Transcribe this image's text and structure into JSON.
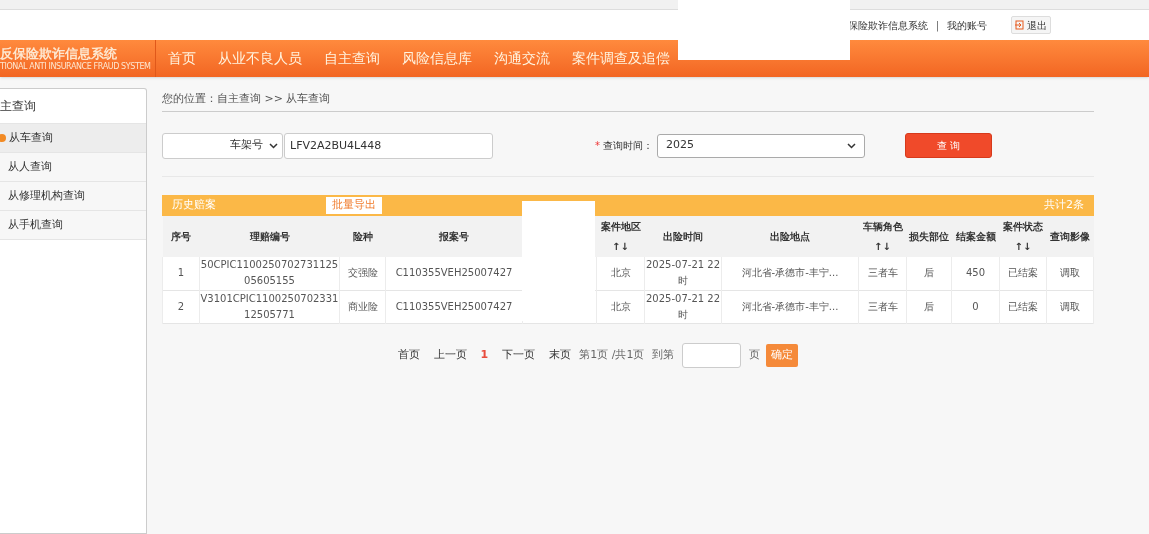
{
  "top_bar": {
    "system_name": "保险欺诈信息系统",
    "separator": "|",
    "account": "我的账号",
    "logout": "退出"
  },
  "logo": {
    "title": "反保险欺诈信息系统",
    "subtitle": "TIONAL ANTI INSURANCE FRAUD SYSTEM"
  },
  "nav": [
    {
      "label": "首页"
    },
    {
      "label": "从业不良人员"
    },
    {
      "label": "自主查询"
    },
    {
      "label": "风险信息库"
    },
    {
      "label": "沟通交流"
    },
    {
      "label": "案件调查及追偿"
    }
  ],
  "sidebar": {
    "title": "主查询",
    "items": [
      {
        "label": "从车查询",
        "selected": true
      },
      {
        "label": "从人查询",
        "selected": false
      },
      {
        "label": "从修理机构查询",
        "selected": false
      },
      {
        "label": "从手机查询",
        "selected": false
      }
    ]
  },
  "breadcrumb": "您的位置：自主查询 >> 从车查询",
  "form": {
    "type_select": "车架号",
    "vin_value": "LFV2A2BU4L448",
    "time_label": "查询时间：",
    "required_mark": "*",
    "year_select": "2025",
    "search_button": "查 询"
  },
  "table": {
    "title": "历史赔案",
    "export_button": "批量导出",
    "total": "共计2条",
    "columns": [
      "序号",
      "理赔编号",
      "险种",
      "报案号",
      "案件地区↑↓",
      "出险时间",
      "出险地点",
      "车辆角色↑↓",
      "损失部位",
      "结案金额",
      "案件状态↑↓",
      "查询影像"
    ],
    "rows": [
      [
        "1",
        "50CPIC110025070273112505605155",
        "交强险",
        "C110355VEH25007427",
        "北京",
        "2025-07-21 22时",
        "河北省-承德市-丰宁...",
        "三者车",
        "后",
        "450",
        "已结案",
        "调取"
      ],
      [
        "2",
        "V3101CPIC110025070233112505771",
        "商业险",
        "C110355VEH25007427",
        "北京",
        "2025-07-21 22时",
        "河北省-承德市-丰宁...",
        "三者车",
        "后",
        "0",
        "已结案",
        "调取"
      ]
    ]
  },
  "pagination": {
    "first": "首页",
    "prev": "上一页",
    "current": "1",
    "next": "下一页",
    "last": "末页",
    "info": "第1页 /共1页",
    "goto_label": "到第",
    "page_unit": "页",
    "confirm": "确定"
  }
}
